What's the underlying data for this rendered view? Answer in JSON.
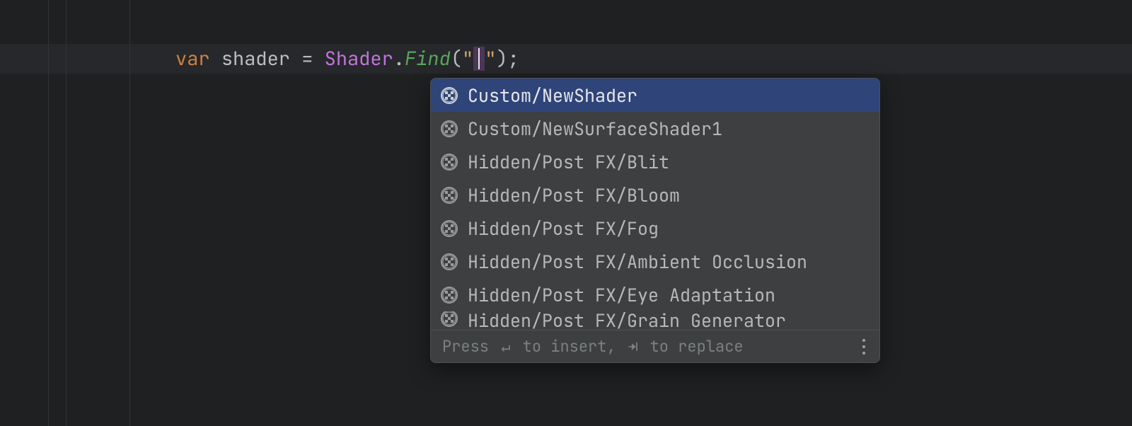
{
  "code": {
    "keyword": "var",
    "identifier": "shader",
    "assign": "=",
    "type": "Shader",
    "dot": ".",
    "method": "Find",
    "open_paren": "(",
    "string_open": "\"",
    "string_close": "\"",
    "close_paren": ")",
    "semicolon": ";"
  },
  "completion": {
    "items": [
      {
        "label": "Custom/NewShader",
        "selected": true
      },
      {
        "label": "Custom/NewSurfaceShader1",
        "selected": false
      },
      {
        "label": "Hidden/Post FX/Blit",
        "selected": false
      },
      {
        "label": "Hidden/Post FX/Bloom",
        "selected": false
      },
      {
        "label": "Hidden/Post FX/Fog",
        "selected": false
      },
      {
        "label": "Hidden/Post FX/Ambient Occlusion",
        "selected": false
      },
      {
        "label": "Hidden/Post FX/Eye Adaptation",
        "selected": false
      },
      {
        "label": "Hidden/Post FX/Grain Generator",
        "selected": false,
        "cut": true
      }
    ],
    "footer": {
      "press": "Press ",
      "enter_glyph": "↵",
      "to_insert": " to insert, ",
      "tab_glyph": "⇥",
      "to_replace": " to replace"
    }
  },
  "colors": {
    "background": "#1f2022",
    "line_highlight": "#26282b",
    "popup_bg": "#3d3f41",
    "selection_bg": "#2f4479",
    "keyword": "#cd8041",
    "type": "#c174d9",
    "method": "#58a55b",
    "string": "#c9a26d"
  }
}
